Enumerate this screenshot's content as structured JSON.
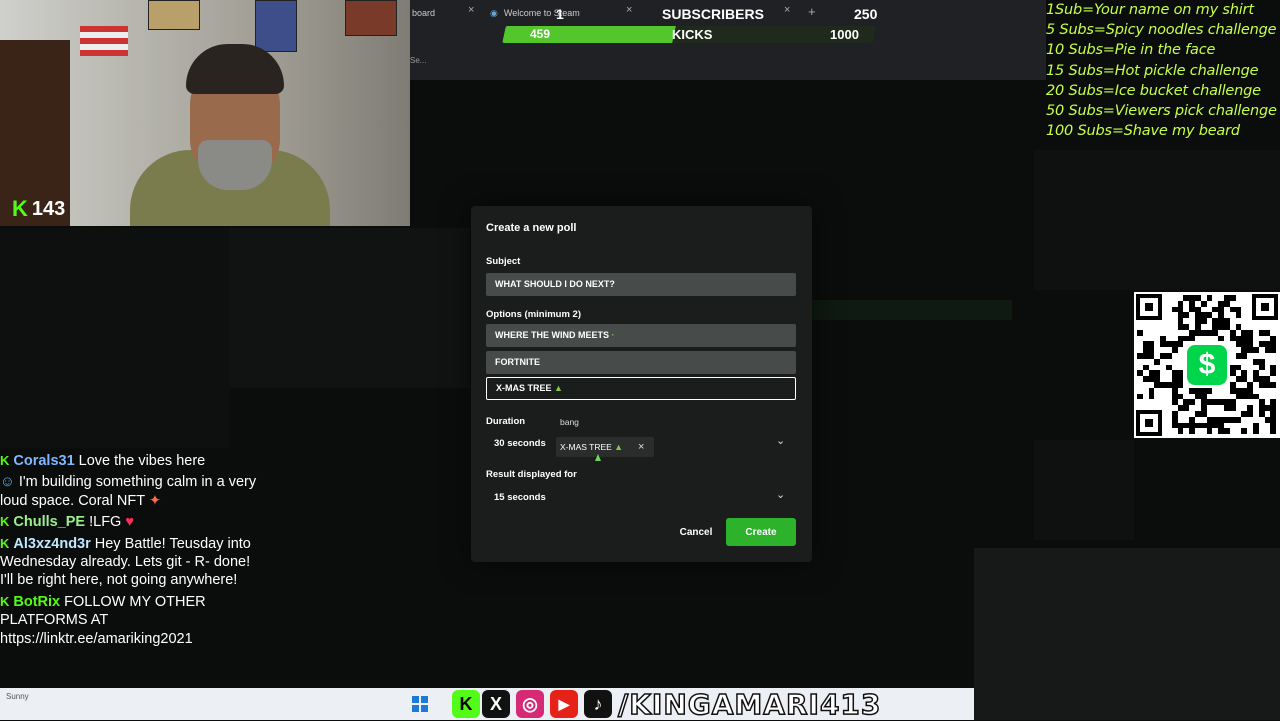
{
  "webcam": {
    "kick_count": "143",
    "kick_badge": "K"
  },
  "browser": {
    "tabs": [
      {
        "label": "board",
        "close": "×"
      },
      {
        "label": "Welcome to Steam",
        "close": "×"
      },
      {
        "label": "",
        "close": "×"
      }
    ],
    "new_tab": "+",
    "address_hint": "Se..."
  },
  "goal_overlay": {
    "subs_current": "1",
    "subs_label": "SUBSCRIBERS",
    "subs_target": "250",
    "kicks_current": "459",
    "kicks_label": "KICKS",
    "kicks_target": "1000",
    "kicks_progress": 0.459,
    "bar_color": "#53c62b"
  },
  "sub_goals": [
    "1Sub=Your name on my shirt",
    "5 Subs=Spicy noodles challenge",
    "10 Subs=Pie in the face",
    "15 Subs=Hot pickle challenge",
    "20 Subs=Ice bucket challenge",
    "50 Subs=Viewers pick challenge",
    "100 Subs=Shave my beard"
  ],
  "qr": {
    "logo": "$",
    "logo_color": "#00d54b"
  },
  "chat": [
    {
      "badge": "K",
      "user": "Corals31",
      "user_color": "#7fb8ff",
      "text": "Love the vibes here"
    },
    {
      "badge": "",
      "user": "",
      "user_color": "#ffffff",
      "text": "I'm building something calm in a very loud space. Coral NFT"
    },
    {
      "badge": "K",
      "user": "Chulls_PE",
      "user_color": "#9cf08c",
      "text": "!LFG"
    },
    {
      "badge": "K",
      "user": "Al3xz4nd3r",
      "user_color": "#bfe7ff",
      "text": "Hey Battle! Teusday into Wednesday already. Lets git - R- done! I'll be right here, not going anywhere!"
    },
    {
      "badge": "K",
      "user": "BotRix",
      "user_color": "#53fc18",
      "text": "FOLLOW MY OTHER PLATFORMS AT https://linktr.ee/amariking2021"
    }
  ],
  "taskbar": {
    "user_hint": "Sunny",
    "handle": "/KINGAMARI413",
    "socials": [
      {
        "icon": "kick-icon",
        "glyph": "K",
        "color": "#53fc18"
      },
      {
        "icon": "x-icon",
        "glyph": "X",
        "color": "#111111"
      },
      {
        "icon": "instagram-icon",
        "glyph": "◎",
        "color": "#d62976"
      },
      {
        "icon": "youtube-icon",
        "glyph": "▶",
        "color": "#e62117"
      },
      {
        "icon": "tiktok-icon",
        "glyph": "♪",
        "color": "#111111"
      }
    ]
  },
  "poll": {
    "title": "Create a new poll",
    "subject_label": "Subject",
    "subject_value": "WHAT SHOULD I DO NEXT?",
    "options_label": "Options (minimum 2)",
    "options": [
      "WHERE THE WIND MEETS",
      "FORTNITE",
      "X-MAS TREE"
    ],
    "duration_label": "Duration",
    "duration_value": "30 seconds",
    "autocomplete_hint": "bang",
    "autocomplete_chip": "X-MAS TREE",
    "result_label": "Result displayed for",
    "result_value": "15 seconds",
    "cancel_label": "Cancel",
    "create_label": "Create",
    "create_color": "#2db22b"
  }
}
